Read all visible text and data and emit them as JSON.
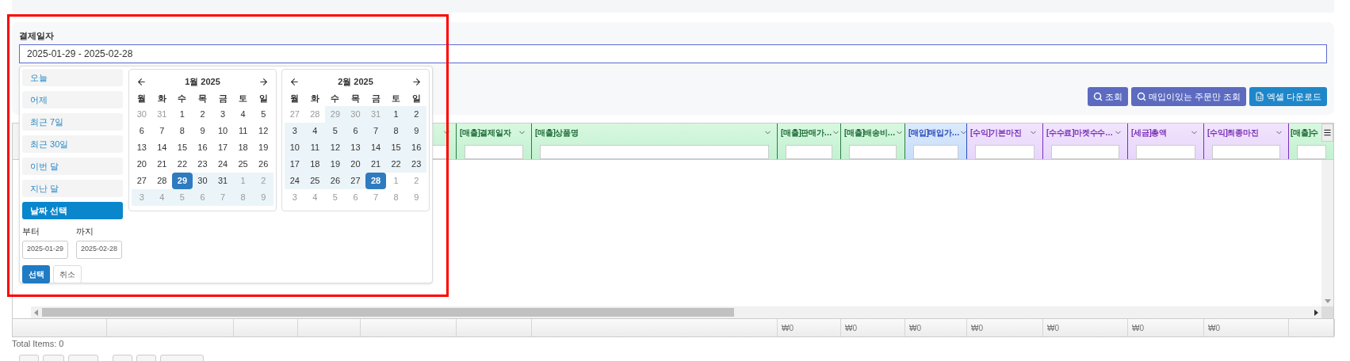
{
  "filter": {
    "label": "결제일자",
    "value": "2025-01-29 - 2025-02-28"
  },
  "actions": [
    {
      "label": "조회",
      "kind": "search"
    },
    {
      "label": "매입이있는 주문만 조회",
      "kind": "search"
    },
    {
      "label": "엑셀 다운로드",
      "kind": "excel"
    }
  ],
  "picker": {
    "presets": [
      {
        "label": "오늘",
        "selected": false
      },
      {
        "label": "어제",
        "selected": false
      },
      {
        "label": "최근 7일",
        "selected": false
      },
      {
        "label": "최근 30일",
        "selected": false
      },
      {
        "label": "이번 달",
        "selected": false
      },
      {
        "label": "지난 달",
        "selected": false
      },
      {
        "label": "날짜 선택",
        "selected": true
      }
    ],
    "from_label": "부터",
    "to_label": "까지",
    "from_value": "2025-01-29",
    "to_value": "2025-02-28",
    "apply": "선택",
    "cancel": "취소",
    "calendars": [
      {
        "title": "1월 2025",
        "weekdays": [
          "월",
          "화",
          "수",
          "목",
          "금",
          "토",
          "일"
        ],
        "weeks": [
          [
            {
              "d": "30",
              "off": true,
              "in_range": false,
              "selected": false
            },
            {
              "d": "31",
              "off": true,
              "in_range": false,
              "selected": false
            },
            {
              "d": "1",
              "off": false,
              "in_range": false,
              "selected": false
            },
            {
              "d": "2",
              "off": false,
              "in_range": false,
              "selected": false
            },
            {
              "d": "3",
              "off": false,
              "in_range": false,
              "selected": false
            },
            {
              "d": "4",
              "off": false,
              "in_range": false,
              "selected": false
            },
            {
              "d": "5",
              "off": false,
              "in_range": false,
              "selected": false
            }
          ],
          [
            {
              "d": "6",
              "off": false,
              "in_range": false,
              "selected": false
            },
            {
              "d": "7",
              "off": false,
              "in_range": false,
              "selected": false
            },
            {
              "d": "8",
              "off": false,
              "in_range": false,
              "selected": false
            },
            {
              "d": "9",
              "off": false,
              "in_range": false,
              "selected": false
            },
            {
              "d": "10",
              "off": false,
              "in_range": false,
              "selected": false
            },
            {
              "d": "11",
              "off": false,
              "in_range": false,
              "selected": false
            },
            {
              "d": "12",
              "off": false,
              "in_range": false,
              "selected": false
            }
          ],
          [
            {
              "d": "13",
              "off": false,
              "in_range": false,
              "selected": false
            },
            {
              "d": "14",
              "off": false,
              "in_range": false,
              "selected": false
            },
            {
              "d": "15",
              "off": false,
              "in_range": false,
              "selected": false
            },
            {
              "d": "16",
              "off": false,
              "in_range": false,
              "selected": false
            },
            {
              "d": "17",
              "off": false,
              "in_range": false,
              "selected": false
            },
            {
              "d": "18",
              "off": false,
              "in_range": false,
              "selected": false
            },
            {
              "d": "19",
              "off": false,
              "in_range": false,
              "selected": false
            }
          ],
          [
            {
              "d": "20",
              "off": false,
              "in_range": false,
              "selected": false
            },
            {
              "d": "21",
              "off": false,
              "in_range": false,
              "selected": false
            },
            {
              "d": "22",
              "off": false,
              "in_range": false,
              "selected": false
            },
            {
              "d": "23",
              "off": false,
              "in_range": false,
              "selected": false
            },
            {
              "d": "24",
              "off": false,
              "in_range": false,
              "selected": false
            },
            {
              "d": "25",
              "off": false,
              "in_range": false,
              "selected": false
            },
            {
              "d": "26",
              "off": false,
              "in_range": false,
              "selected": false
            }
          ],
          [
            {
              "d": "27",
              "off": false,
              "in_range": false,
              "selected": false
            },
            {
              "d": "28",
              "off": false,
              "in_range": false,
              "selected": false
            },
            {
              "d": "29",
              "off": false,
              "in_range": true,
              "selected": true
            },
            {
              "d": "30",
              "off": false,
              "in_range": true,
              "selected": false
            },
            {
              "d": "31",
              "off": false,
              "in_range": true,
              "selected": false
            },
            {
              "d": "1",
              "off": true,
              "in_range": true,
              "selected": false
            },
            {
              "d": "2",
              "off": true,
              "in_range": true,
              "selected": false
            }
          ],
          [
            {
              "d": "3",
              "off": true,
              "in_range": true,
              "selected": false
            },
            {
              "d": "4",
              "off": true,
              "in_range": true,
              "selected": false
            },
            {
              "d": "5",
              "off": true,
              "in_range": true,
              "selected": false
            },
            {
              "d": "6",
              "off": true,
              "in_range": true,
              "selected": false
            },
            {
              "d": "7",
              "off": true,
              "in_range": true,
              "selected": false
            },
            {
              "d": "8",
              "off": true,
              "in_range": true,
              "selected": false
            },
            {
              "d": "9",
              "off": true,
              "in_range": true,
              "selected": false
            }
          ]
        ]
      },
      {
        "title": "2월 2025",
        "weekdays": [
          "월",
          "화",
          "수",
          "목",
          "금",
          "토",
          "일"
        ],
        "weeks": [
          [
            {
              "d": "27",
              "off": true,
              "in_range": false,
              "selected": false
            },
            {
              "d": "28",
              "off": true,
              "in_range": false,
              "selected": false
            },
            {
              "d": "29",
              "off": true,
              "in_range": true,
              "selected": false
            },
            {
              "d": "30",
              "off": true,
              "in_range": true,
              "selected": false
            },
            {
              "d": "31",
              "off": true,
              "in_range": true,
              "selected": false
            },
            {
              "d": "1",
              "off": false,
              "in_range": true,
              "selected": false
            },
            {
              "d": "2",
              "off": false,
              "in_range": true,
              "selected": false
            }
          ],
          [
            {
              "d": "3",
              "off": false,
              "in_range": true,
              "selected": false
            },
            {
              "d": "4",
              "off": false,
              "in_range": true,
              "selected": false
            },
            {
              "d": "5",
              "off": false,
              "in_range": true,
              "selected": false
            },
            {
              "d": "6",
              "off": false,
              "in_range": true,
              "selected": false
            },
            {
              "d": "7",
              "off": false,
              "in_range": true,
              "selected": false
            },
            {
              "d": "8",
              "off": false,
              "in_range": true,
              "selected": false
            },
            {
              "d": "9",
              "off": false,
              "in_range": true,
              "selected": false
            }
          ],
          [
            {
              "d": "10",
              "off": false,
              "in_range": true,
              "selected": false
            },
            {
              "d": "11",
              "off": false,
              "in_range": true,
              "selected": false
            },
            {
              "d": "12",
              "off": false,
              "in_range": true,
              "selected": false
            },
            {
              "d": "13",
              "off": false,
              "in_range": true,
              "selected": false
            },
            {
              "d": "14",
              "off": false,
              "in_range": true,
              "selected": false
            },
            {
              "d": "15",
              "off": false,
              "in_range": true,
              "selected": false
            },
            {
              "d": "16",
              "off": false,
              "in_range": true,
              "selected": false
            }
          ],
          [
            {
              "d": "17",
              "off": false,
              "in_range": true,
              "selected": false
            },
            {
              "d": "18",
              "off": false,
              "in_range": true,
              "selected": false
            },
            {
              "d": "19",
              "off": false,
              "in_range": true,
              "selected": false
            },
            {
              "d": "20",
              "off": false,
              "in_range": true,
              "selected": false
            },
            {
              "d": "21",
              "off": false,
              "in_range": true,
              "selected": false
            },
            {
              "d": "22",
              "off": false,
              "in_range": true,
              "selected": false
            },
            {
              "d": "23",
              "off": false,
              "in_range": true,
              "selected": false
            }
          ],
          [
            {
              "d": "24",
              "off": false,
              "in_range": true,
              "selected": false
            },
            {
              "d": "25",
              "off": false,
              "in_range": true,
              "selected": false
            },
            {
              "d": "26",
              "off": false,
              "in_range": true,
              "selected": false
            },
            {
              "d": "27",
              "off": false,
              "in_range": true,
              "selected": false
            },
            {
              "d": "28",
              "off": false,
              "in_range": true,
              "selected": true
            },
            {
              "d": "1",
              "off": true,
              "in_range": false,
              "selected": false
            },
            {
              "d": "2",
              "off": true,
              "in_range": false,
              "selected": false
            }
          ],
          [
            {
              "d": "3",
              "off": true,
              "in_range": false,
              "selected": false
            },
            {
              "d": "4",
              "off": true,
              "in_range": false,
              "selected": false
            },
            {
              "d": "5",
              "off": true,
              "in_range": false,
              "selected": false
            },
            {
              "d": "6",
              "off": true,
              "in_range": false,
              "selected": false
            },
            {
              "d": "7",
              "off": true,
              "in_range": false,
              "selected": false
            },
            {
              "d": "8",
              "off": true,
              "in_range": false,
              "selected": false
            },
            {
              "d": "9",
              "off": true,
              "in_range": false,
              "selected": false
            }
          ]
        ]
      }
    ]
  },
  "grid": {
    "columns": [
      {},
      {},
      {},
      {},
      {
        "kind": "sales",
        "sortable": true,
        "filter": true
      },
      {
        "kind": "sales",
        "label": "[매출]결제일자",
        "sortable": true,
        "filter": true
      },
      {
        "kind": "sales",
        "label": "[매출]상품명",
        "sortable": true,
        "filter": true
      },
      {
        "kind": "sales",
        "label": "[매출]판매가…",
        "sortable": true,
        "filter": true,
        "total": "₩0"
      },
      {
        "kind": "sales",
        "label": "[매출]배송비…",
        "sortable": true,
        "filter": true,
        "total": "₩0"
      },
      {
        "kind": "purchase",
        "label": "[매입]매입가…",
        "sortable": true,
        "filter": true,
        "total": "₩0"
      },
      {
        "kind": "profit",
        "label": "[수익]기본마진",
        "sortable": true,
        "filter": true,
        "total": "₩0"
      },
      {
        "kind": "profit",
        "label": "[수수료]마켓수수…",
        "sortable": true,
        "filter": true,
        "total": "₩0"
      },
      {
        "kind": "profit",
        "label": "[세금]총액",
        "sortable": true,
        "filter": true,
        "total": "₩0"
      },
      {
        "kind": "profit",
        "label": "[수익]최종마진",
        "sortable": true,
        "filter": true,
        "total": "₩0"
      },
      {
        "kind": "sales",
        "label": "[매출]수",
        "sortable": false,
        "filter": true
      }
    ],
    "total_items": "Total Items: 0"
  }
}
